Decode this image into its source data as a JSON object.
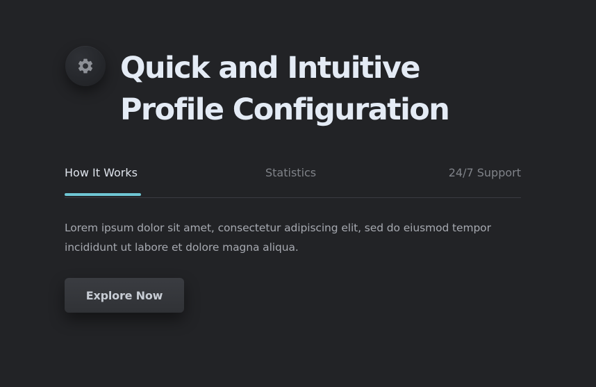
{
  "hero": {
    "icon": "gear-icon",
    "title_lines": [
      "Quick and Intuitive",
      "Profile Configuration"
    ],
    "tabs": [
      {
        "label": "How It Works",
        "active": true
      },
      {
        "label": "Statistics",
        "active": false
      },
      {
        "label": "24/7 Support",
        "active": false
      }
    ],
    "body": "Lorem ipsum dolor sit amet, consectetur adipiscing elit, sed do eiusmod tempor incididunt ut labore et dolore magna aliqua.",
    "cta_label": "Explore Now"
  },
  "colors": {
    "background": "#222326",
    "accent": "#6fc6d4",
    "title": "#e4ebf5",
    "muted_text": "#808389"
  }
}
